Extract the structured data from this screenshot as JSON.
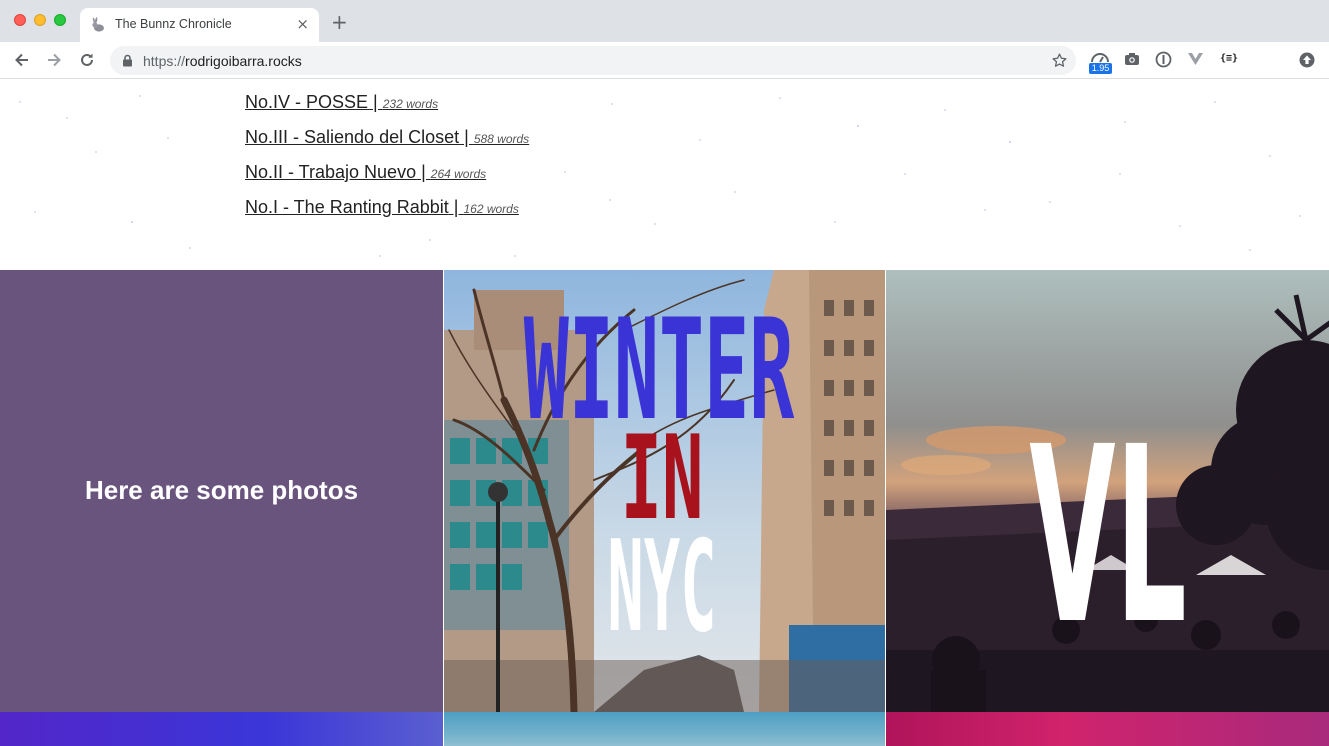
{
  "browser": {
    "tab_title": "The Bunnz Chronicle",
    "tab_close": "×",
    "new_tab": "+",
    "url_scheme": "https://",
    "url_host": "rodrigoibarra.rocks",
    "extension_badge": "1.95",
    "extension_json_label": "{≡}"
  },
  "posts": [
    {
      "title": "No.IV - POSSE",
      "separator": " | ",
      "words": "232 words"
    },
    {
      "title": "No.III - Saliendo del Closet",
      "separator": " | ",
      "words": "588 words"
    },
    {
      "title": "No.II - Trabajo Nuevo",
      "separator": " | ",
      "words": "264 words"
    },
    {
      "title": "No.I - The Ranting Rabbit",
      "separator": " | ",
      "words": "162 words"
    }
  ],
  "gallery": {
    "heading": "Here are some photos",
    "nyc_line1": "WINTER",
    "nyc_line2": "IN",
    "nyc_line3": "NYC",
    "vl_text": "VL"
  },
  "colors": {
    "purple_tile": "#69547e",
    "winter_blue": "#3a34d6",
    "in_red": "#a8121c"
  }
}
